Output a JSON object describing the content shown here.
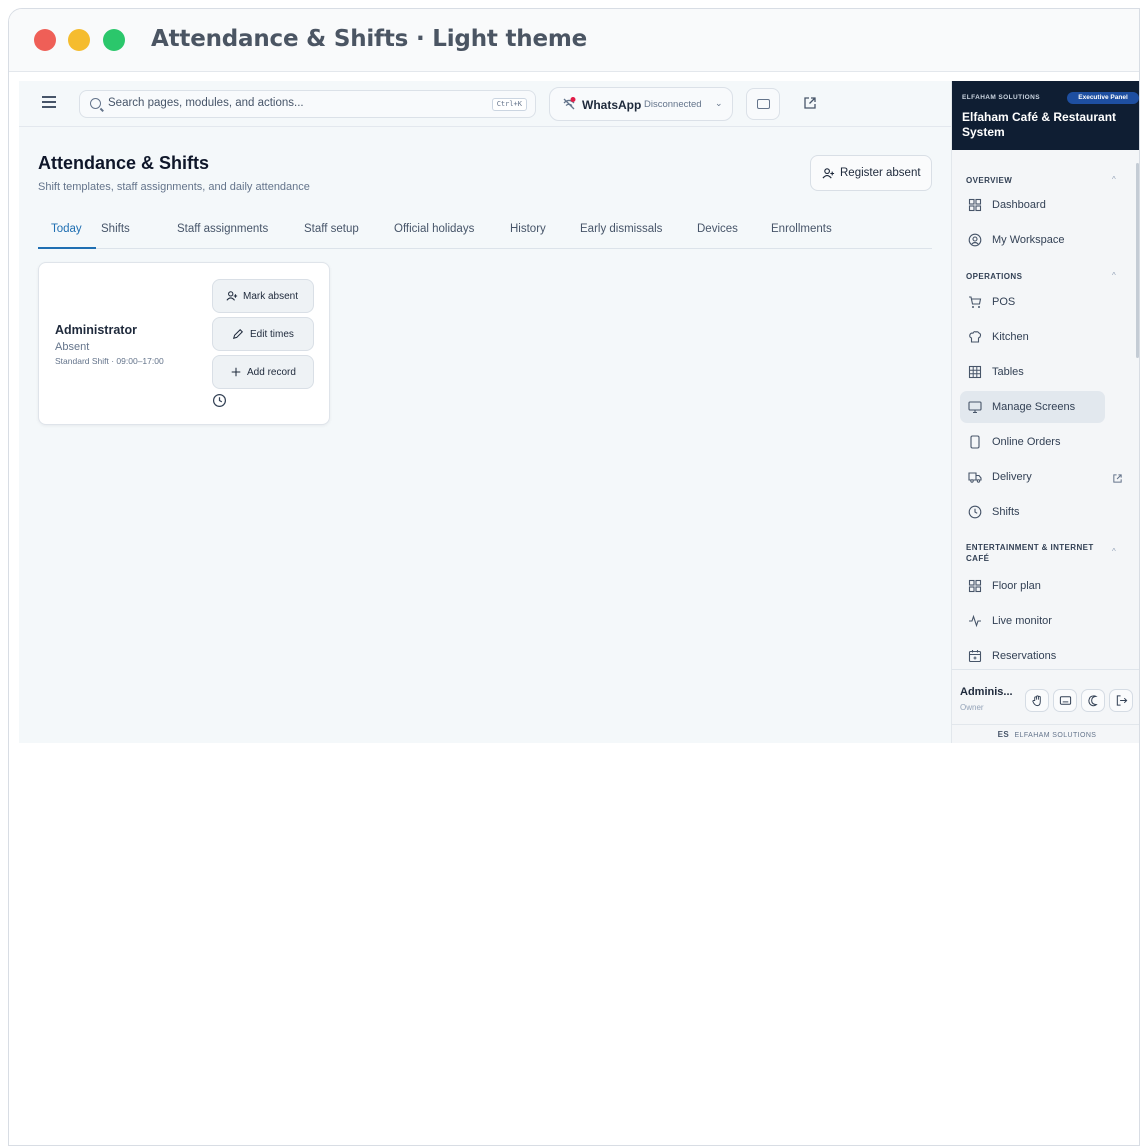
{
  "window": {
    "title": "Attendance & Shifts · Light theme"
  },
  "topbar": {
    "search_placeholder": "Search pages, modules, and actions...",
    "search_shortcut": "Ctrl+K",
    "whatsapp_label": "WhatsApp",
    "whatsapp_status": "Disconnected"
  },
  "page": {
    "title": "Attendance & Shifts",
    "subtitle": "Shift templates, staff assignments, and daily attendance",
    "register_absent": "Register absent",
    "tabs": [
      {
        "label": "Today"
      },
      {
        "label": "Shifts"
      },
      {
        "label": "Staff assignments"
      },
      {
        "label": "Staff setup"
      },
      {
        "label": "Official holidays"
      },
      {
        "label": "History"
      },
      {
        "label": "Early dismissals"
      },
      {
        "label": "Devices"
      },
      {
        "label": "Enrollments"
      }
    ],
    "active_tab": "Today"
  },
  "card": {
    "name": "Administrator",
    "status": "Absent",
    "shift": "Standard Shift · 09:00–17:00",
    "mark_absent": "Mark absent",
    "edit_times": "Edit times",
    "add_record": "Add record"
  },
  "sidebar": {
    "brand": "ELFAHAM SOLUTIONS",
    "badge": "Executive Panel",
    "title": "Elfaham Café & Restaurant System",
    "sections": [
      {
        "label": "OVERVIEW",
        "items": [
          {
            "label": "Dashboard",
            "icon": "grid-icon"
          },
          {
            "label": "My Workspace",
            "icon": "user-circle-icon"
          }
        ]
      },
      {
        "label": "OPERATIONS",
        "items": [
          {
            "label": "POS",
            "icon": "cart-icon"
          },
          {
            "label": "Kitchen",
            "icon": "chef-hat-icon"
          },
          {
            "label": "Tables",
            "icon": "table-icon"
          },
          {
            "label": "Manage Screens",
            "icon": "monitor-icon"
          },
          {
            "label": "Online Orders",
            "icon": "phone-icon"
          },
          {
            "label": "Delivery",
            "icon": "truck-icon"
          },
          {
            "label": "Shifts",
            "icon": "clock-icon"
          }
        ]
      },
      {
        "label": "ENTERTAINMENT & INTERNET CAFÉ",
        "items": [
          {
            "label": "Floor plan",
            "icon": "grid-icon"
          },
          {
            "label": "Live monitor",
            "icon": "activity-icon"
          },
          {
            "label": "Reservations",
            "icon": "calendar-icon"
          }
        ]
      }
    ],
    "active_item": "Manage Screens",
    "user_name": "Adminis...",
    "user_role": "Owner",
    "footer_mark": "ES",
    "footer_brand": "ELFAHAM SOLUTIONS"
  },
  "colors": {
    "accent": "#1f6fb2",
    "sidebar_header": "#0f1e33",
    "badge": "#1e4fa1",
    "status_dot": "#e11d48"
  }
}
